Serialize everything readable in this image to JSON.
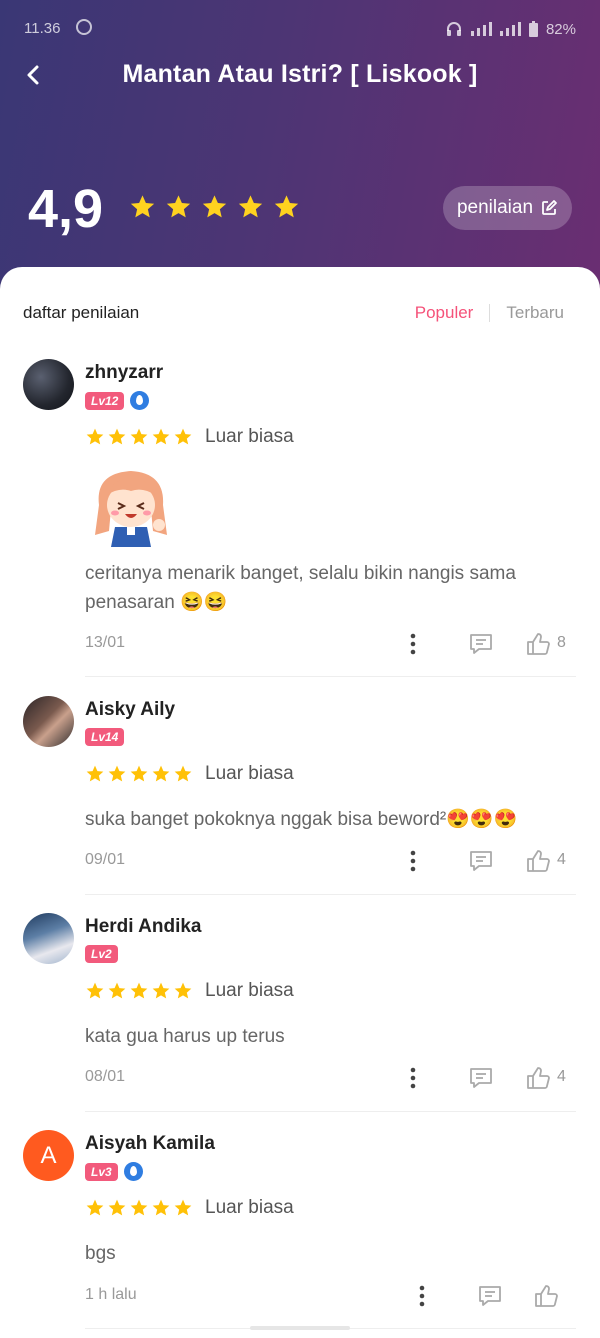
{
  "status": {
    "time": "11.36",
    "battery": "82%"
  },
  "header": {
    "title": "Mantan Atau Istri? [ Liskook ]"
  },
  "rating": {
    "average": "4,9",
    "stars": 5,
    "rate_button_label": "penilaian"
  },
  "list": {
    "heading": "daftar penilaian",
    "sort_popular": "Populer",
    "sort_newest": "Terbaru"
  },
  "colors": {
    "accent": "#f5527a",
    "star": "#ffc107",
    "level_badge": "#f25a7c"
  },
  "reviews": [
    {
      "username": "zhnyzarr",
      "level": "Lv12",
      "vip": true,
      "stars": 5,
      "rating_label": "Luar biasa",
      "sticker": true,
      "comment": "ceritanya menarik banget, selalu bikin nangis sama penasaran 😆😆",
      "date": "13/01",
      "likes": "8"
    },
    {
      "username": "Aisky Aily",
      "level": "Lv14",
      "vip": false,
      "stars": 5,
      "rating_label": "Luar biasa",
      "sticker": false,
      "comment": "suka banget pokoknya nggak bisa beword²😍😍😍",
      "date": "09/01",
      "likes": "4"
    },
    {
      "username": "Herdi Andika",
      "level": "Lv2",
      "vip": false,
      "stars": 5,
      "rating_label": "Luar biasa",
      "sticker": false,
      "comment": "kata gua harus up terus",
      "date": "08/01",
      "likes": "4"
    },
    {
      "username": "Aisyah Kamila",
      "avatar_letter": "A",
      "level": "Lv3",
      "vip": true,
      "stars": 5,
      "rating_label": "Luar biasa",
      "sticker": false,
      "comment": "bgs",
      "date": "1 h lalu",
      "likes": ""
    }
  ]
}
